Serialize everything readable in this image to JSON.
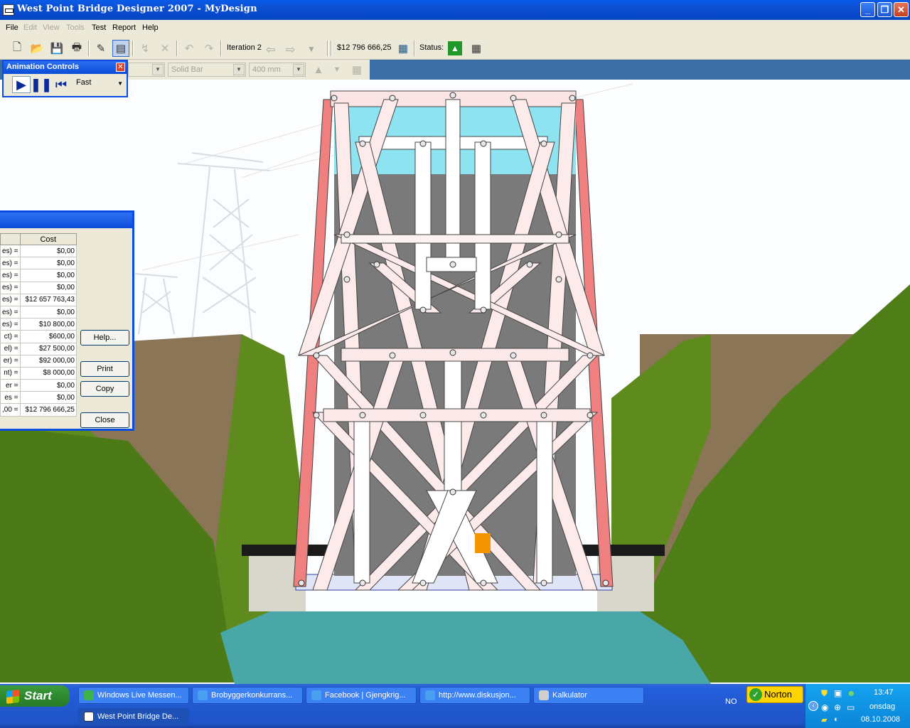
{
  "window": {
    "title": "West Point Bridge Designer 2007 - MyDesign"
  },
  "menu": [
    {
      "label": "File",
      "enabled": true
    },
    {
      "label": "Edit",
      "enabled": false
    },
    {
      "label": "View",
      "enabled": false
    },
    {
      "label": "Tools",
      "enabled": false
    },
    {
      "label": "Test",
      "enabled": true
    },
    {
      "label": "Report",
      "enabled": true
    },
    {
      "label": "Help",
      "enabled": true
    }
  ],
  "toolbar": {
    "iteration_label": "Iteration 2",
    "cost": "$12 796 666,25",
    "status_label": "Status:"
  },
  "toolbar2": {
    "material": "",
    "shape": "Solid Bar",
    "size": "400 mm"
  },
  "animation_controls": {
    "title": "Animation Controls",
    "speed": "Fast"
  },
  "cost_dialog": {
    "column_header": "Cost",
    "rows": [
      {
        "label": "es) =",
        "value": "$0,00"
      },
      {
        "label": "es) =",
        "value": "$0,00"
      },
      {
        "label": "es) =",
        "value": "$0,00"
      },
      {
        "label": "es) =",
        "value": "$0,00"
      },
      {
        "label": "es) =",
        "value": "$12 657 763,43"
      },
      {
        "label": "es) =",
        "value": "$0,00"
      },
      {
        "label": "es) =",
        "value": "$10 800,00"
      },
      {
        "label": "ct) =",
        "value": "$600,00"
      },
      {
        "label": "el) =",
        "value": "$27 500,00"
      },
      {
        "label": "er) =",
        "value": "$92 000,00"
      },
      {
        "label": "nt) =",
        "value": "$8 000,00"
      },
      {
        "label": "er =",
        "value": "$0,00"
      },
      {
        "label": "es =",
        "value": "$0,00"
      },
      {
        "label": ",00 =",
        "value": "$12 796 666,25"
      }
    ],
    "buttons": {
      "help": "Help...",
      "print": "Print",
      "copy": "Copy",
      "close": "Close"
    }
  },
  "taskbar": {
    "start": "Start",
    "tasks": [
      {
        "label": "Windows Live Messen...",
        "icon": "messenger-icon",
        "color": "#3bb34a"
      },
      {
        "label": "Brobyggerkonkurrans...",
        "icon": "ie-icon",
        "color": "#4aa0f0"
      },
      {
        "label": "Facebook | Gjengkrig...",
        "icon": "ie-icon",
        "color": "#4aa0f0"
      },
      {
        "label": "http://www.diskusjon...",
        "icon": "ie-icon",
        "color": "#4aa0f0"
      },
      {
        "label": "Kalkulator",
        "icon": "calculator-icon",
        "color": "#cfcfcf"
      },
      {
        "label": "West Point Bridge De...",
        "icon": "bridge-app-icon",
        "color": "#ffffff"
      }
    ],
    "language": "NO",
    "norton": "Norton",
    "clock": {
      "time": "13:47",
      "day": "onsdag",
      "date": "08.10.2008"
    }
  },
  "colors": {
    "xp_blue": "#0b4fd0",
    "tension_member": "#f8d8d8",
    "compression_member": "#f08080",
    "water": "#4aa7a8",
    "grass": "#5f8f1f"
  }
}
